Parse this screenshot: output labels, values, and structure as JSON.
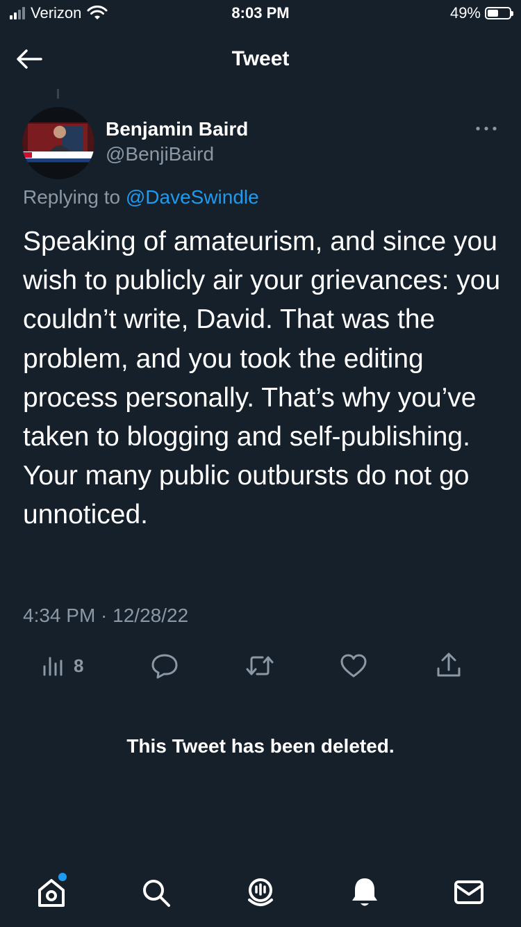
{
  "status_bar": {
    "carrier": "Verizon",
    "time": "8:03 PM",
    "battery_percent": "49%",
    "battery_level": 0.49,
    "icons": [
      "signal-icon",
      "wifi-icon",
      "battery-icon"
    ]
  },
  "header": {
    "title": "Tweet",
    "back_icon": "arrow-left-icon"
  },
  "tweet": {
    "author_name": "Benjamin Baird",
    "author_handle": "@BenjiBaird",
    "replying_prefix": "Replying to ",
    "replying_to": "@DaveSwindle",
    "text": "Speaking of amateurism, and since you wish to publicly air your grievances: you couldn’t write, David. That was the problem, and you took the editing process personally. That’s why you’ve taken to blogging and self-publishing. Your many public outbursts do not go unnoticed.",
    "timestamp": "4:34 PM · 12/28/22",
    "views_count": "8"
  },
  "actions": [
    "views-icon",
    "reply-icon",
    "retweet-icon",
    "like-icon",
    "share-icon"
  ],
  "deleted_notice": "This Tweet has been deleted.",
  "tabbar": {
    "items": [
      "home-icon",
      "search-icon",
      "spaces-icon",
      "notifications-icon",
      "messages-icon"
    ]
  },
  "colors": {
    "background": "#15202b",
    "accent": "#1d9bf0",
    "secondary_text": "#8b98a5"
  }
}
